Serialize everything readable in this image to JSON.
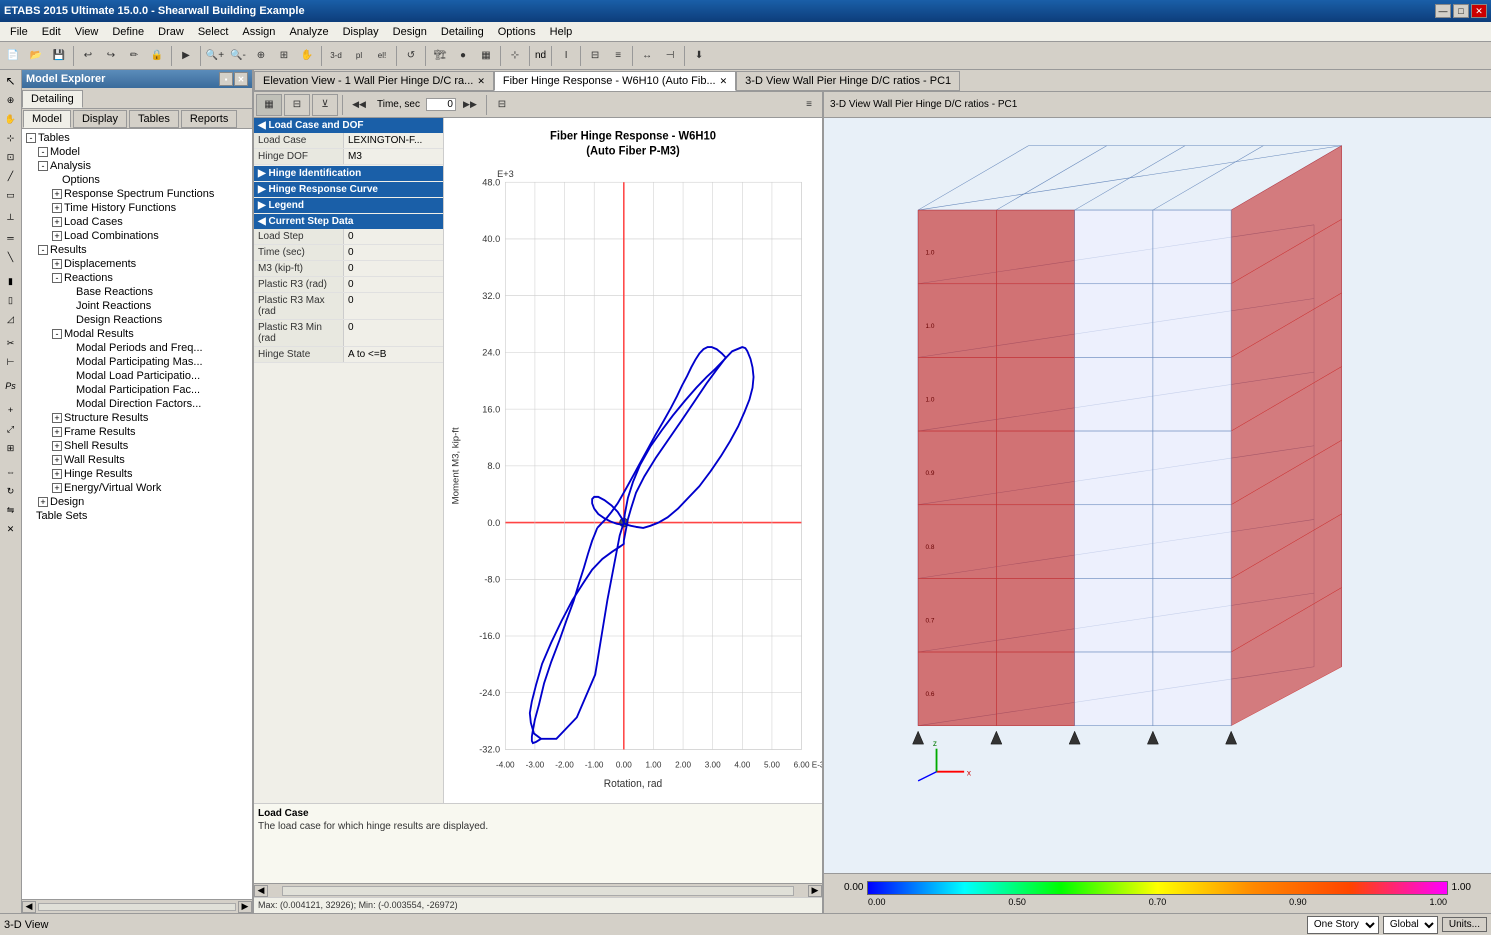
{
  "titlebar": {
    "title": "ETABS 2015 Ultimate 15.0.0 - Shearwall Building Example",
    "min": "—",
    "max": "□",
    "close": "✕"
  },
  "menu": {
    "items": [
      "File",
      "Edit",
      "View",
      "Define",
      "Draw",
      "Select",
      "Assign",
      "Analyze",
      "Display",
      "Design",
      "Detailing",
      "Options",
      "Help"
    ]
  },
  "explorer": {
    "title": "Model Explorer",
    "tabs": [
      "Detailing"
    ],
    "sub_tabs": [
      "Model",
      "Display",
      "Tables",
      "Reports"
    ]
  },
  "tree": {
    "items": [
      {
        "label": "Tables",
        "level": 0,
        "toggle": "-"
      },
      {
        "label": "Model",
        "level": 1,
        "toggle": "-"
      },
      {
        "label": "Analysis",
        "level": 1,
        "toggle": "-"
      },
      {
        "label": "Options",
        "level": 2,
        "toggle": null
      },
      {
        "label": "Response Spectrum Functions",
        "level": 2,
        "toggle": "+"
      },
      {
        "label": "Time History Functions",
        "level": 2,
        "toggle": "+"
      },
      {
        "label": "Load Cases",
        "level": 2,
        "toggle": "+"
      },
      {
        "label": "Load Combinations",
        "level": 2,
        "toggle": "+"
      },
      {
        "label": "Results",
        "level": 1,
        "toggle": "-"
      },
      {
        "label": "Displacements",
        "level": 2,
        "toggle": "+"
      },
      {
        "label": "Reactions",
        "level": 2,
        "toggle": "-"
      },
      {
        "label": "Base Reactions",
        "level": 3,
        "toggle": null
      },
      {
        "label": "Joint Reactions",
        "level": 3,
        "toggle": null
      },
      {
        "label": "Design Reactions",
        "level": 3,
        "toggle": null
      },
      {
        "label": "Modal Results",
        "level": 2,
        "toggle": "-"
      },
      {
        "label": "Modal Periods and Freq...",
        "level": 3,
        "toggle": null
      },
      {
        "label": "Modal Participating Mas...",
        "level": 3,
        "toggle": null
      },
      {
        "label": "Modal Load Participatio...",
        "level": 3,
        "toggle": null
      },
      {
        "label": "Modal Participation Fac...",
        "level": 3,
        "toggle": null
      },
      {
        "label": "Modal Direction Factors...",
        "level": 3,
        "toggle": null
      },
      {
        "label": "Structure Results",
        "level": 2,
        "toggle": "+"
      },
      {
        "label": "Frame Results",
        "level": 2,
        "toggle": "+"
      },
      {
        "label": "Shell Results",
        "level": 2,
        "toggle": "+"
      },
      {
        "label": "Wall Results",
        "level": 2,
        "toggle": "+"
      },
      {
        "label": "Hinge Results",
        "level": 2,
        "toggle": "+"
      },
      {
        "label": "Energy/Virtual Work",
        "level": 2,
        "toggle": "+"
      },
      {
        "label": "Design",
        "level": 1,
        "toggle": "+"
      },
      {
        "label": "Table Sets",
        "level": 0,
        "toggle": null
      }
    ]
  },
  "view_tabs": [
    {
      "label": "Elevation View - 1  Wall Pier Hinge D/C ra...",
      "active": false,
      "closable": true
    },
    {
      "label": "Fiber Hinge Response - W6H10 (Auto Fib...",
      "active": true,
      "closable": true
    },
    {
      "label": "3-D View  Wall Pier Hinge D/C ratios - PC1",
      "active": false,
      "closable": false
    }
  ],
  "fiber_toolbar": {
    "time_label": "Time, sec",
    "time_value": "0",
    "prev": "<<",
    "next": ">>"
  },
  "fiber_props": {
    "sections": [
      {
        "title": "Load Case and DOF",
        "rows": [
          {
            "label": "Load Case",
            "value": "LEXINGTON-F..."
          },
          {
            "label": "Hinge DOF",
            "value": "M3"
          }
        ]
      },
      {
        "title": "Hinge Identification",
        "rows": []
      },
      {
        "title": "Hinge Response Curve",
        "rows": []
      },
      {
        "title": "Legend",
        "rows": []
      },
      {
        "title": "Current Step Data",
        "rows": [
          {
            "label": "Load Step",
            "value": "0"
          },
          {
            "label": "Time (sec)",
            "value": "0"
          },
          {
            "label": "M3 (kip-ft)",
            "value": "0"
          },
          {
            "label": "Plastic R3 (rad)",
            "value": "0"
          },
          {
            "label": "Plastic R3 Max (rad",
            "value": "0"
          },
          {
            "label": "Plastic R3 Min (rad",
            "value": "0"
          },
          {
            "label": "Hinge State",
            "value": "A to <=B"
          }
        ]
      }
    ]
  },
  "chart": {
    "title_line1": "Fiber Hinge Response - W6H10",
    "title_line2": "(Auto Fiber P-M3)",
    "y_axis_label": "Moment M3, kip-ft",
    "x_axis_label": "Rotation, rad",
    "y_max": "E+3",
    "y_ticks": [
      "48.0",
      "40.0",
      "32.0",
      "24.0",
      "16.0",
      "8.0",
      "0.0",
      "-8.0",
      "-16.0",
      "-24.0",
      "-32.0"
    ],
    "x_ticks": [
      "-4.00",
      "-3.00",
      "-2.00",
      "-1.00",
      "0.00",
      "1.00",
      "2.00",
      "3.00",
      "4.00",
      "5.00",
      "6.00"
    ],
    "x_unit": "E-3"
  },
  "fiber_bottom": {
    "section_title": "Load Case",
    "description": "The load case for which hinge results are displayed.",
    "min_max": "Max: (0.004121, 32926);  Min: (-0.003554, -26972)"
  },
  "view_3d": {
    "title": "3-D View  Wall Pier Hinge D/C ratios - PC1"
  },
  "colorbar": {
    "values": [
      "0.00",
      "0.50",
      "0.70",
      "0.90",
      "1.00"
    ]
  },
  "status_bar": {
    "left": "3-D View",
    "story_label": "One Story",
    "global_label": "Global",
    "units_label": "Units..."
  }
}
